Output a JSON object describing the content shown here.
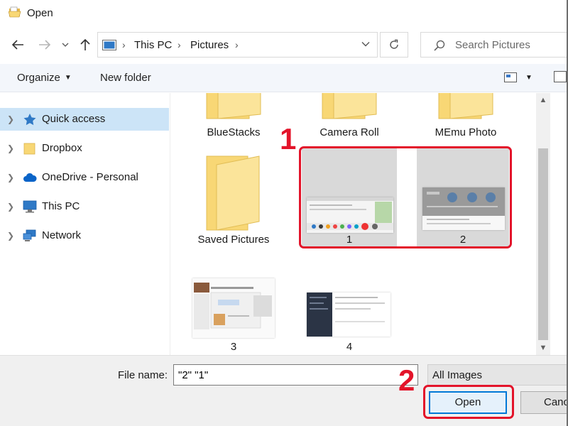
{
  "window": {
    "title": "Open"
  },
  "address_bar": {
    "crumbs": [
      "This PC",
      "Pictures"
    ]
  },
  "search": {
    "placeholder": "Search Pictures"
  },
  "command_bar": {
    "organize_label": "Organize",
    "new_folder_label": "New folder"
  },
  "sidebar": {
    "items": [
      {
        "label": "Quick access",
        "icon": "star-icon",
        "selected": true
      },
      {
        "label": "Dropbox",
        "icon": "folder-icon",
        "selected": false
      },
      {
        "label": "OneDrive - Personal",
        "icon": "cloud-icon",
        "selected": false
      },
      {
        "label": "This PC",
        "icon": "computer-icon",
        "selected": false
      },
      {
        "label": "Network",
        "icon": "network-icon",
        "selected": false
      }
    ]
  },
  "files": {
    "items": [
      {
        "name": "BlueStacks",
        "type": "folder"
      },
      {
        "name": "Camera Roll",
        "type": "folder"
      },
      {
        "name": "MEmu Photo",
        "type": "folder"
      },
      {
        "name": "Saved Pictures",
        "type": "folder"
      },
      {
        "name": "1",
        "type": "image",
        "selected": true
      },
      {
        "name": "2",
        "type": "image",
        "selected": true
      },
      {
        "name": "3",
        "type": "image",
        "selected": false
      },
      {
        "name": "4",
        "type": "image",
        "selected": false
      }
    ]
  },
  "bottom": {
    "file_name_label": "File name:",
    "file_name_value": "\"2\" \"1\"",
    "file_type_value": "All Images",
    "open_label": "Open",
    "cancel_label": "Cancel"
  },
  "annotations": {
    "step1": "1",
    "step2": "2"
  },
  "colors": {
    "accent": "#0078d7",
    "selection": "#cce4f7",
    "annotation": "#e3142a",
    "folder": "#f8d775"
  }
}
